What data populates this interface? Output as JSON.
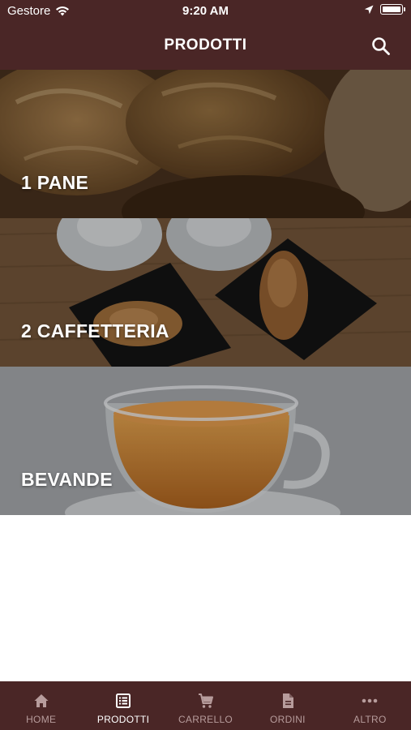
{
  "status_bar": {
    "carrier": "Gestore",
    "time": "9:20 AM"
  },
  "header": {
    "title": "PRODOTTI"
  },
  "categories": [
    {
      "label": "1 PANE"
    },
    {
      "label": "2 CAFFETTERIA"
    },
    {
      "label": "BEVANDE"
    }
  ],
  "tab_bar": {
    "items": [
      {
        "label": "HOME",
        "icon": "home-icon",
        "active": false
      },
      {
        "label": "PRODOTTI",
        "icon": "list-icon",
        "active": true
      },
      {
        "label": "CARRELLO",
        "icon": "cart-icon",
        "active": false
      },
      {
        "label": "ORDINI",
        "icon": "document-icon",
        "active": false
      },
      {
        "label": "ALTRO",
        "icon": "more-icon",
        "active": false
      }
    ]
  },
  "colors": {
    "brand": "#4a2626",
    "tab_active": "#ffffff",
    "tab_inactive": "#b79c9c"
  }
}
